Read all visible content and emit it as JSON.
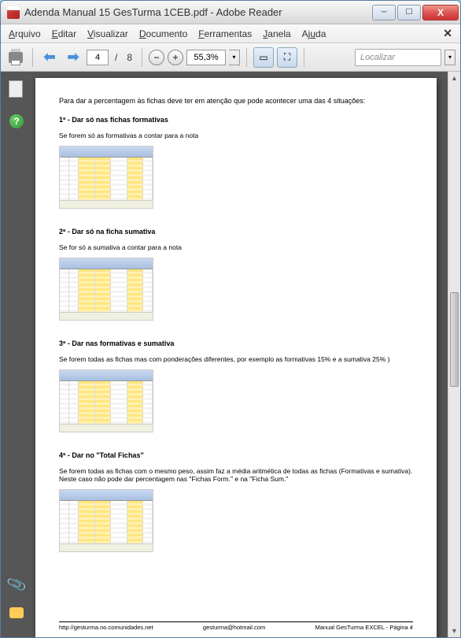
{
  "window": {
    "title": "Adenda Manual 15 GesTurma 1CEB.pdf - Adobe Reader"
  },
  "menu": {
    "arquivo": "Arquivo",
    "editar": "Editar",
    "visualizar": "Visualizar",
    "documento": "Documento",
    "ferramentas": "Ferramentas",
    "janela": "Janela",
    "ajuda": "Ajuda"
  },
  "toolbar": {
    "page_current": "4",
    "page_sep": "/",
    "page_total": "8",
    "zoom_value": "55,3%",
    "search_placeholder": "Localizar"
  },
  "doc": {
    "intro": "Para dar a percentagem às fichas deve ter em atenção que pode acontecer uma das 4 situações:",
    "s1_title": "1ª - Dar só nas fichas formativas",
    "s1_desc": "Se forem só as formativas a contar para a nota",
    "s2_title": "2ª - Dar só na ficha sumativa",
    "s2_desc": "Se for só a sumativa a contar para a nota",
    "s3_title": "3ª - Dar nas formativas e sumativa",
    "s3_desc": "Se forem todas as fichas mas com ponderações diferentes, por exemplo as formativas 15% e a sumativa 25% )",
    "s4_title": "4ª - Dar no \"Total Fichas\"",
    "s4_desc": "Se forem todas as fichas com o mesmo peso, assim faz a média aritmética de todas as fichas (Formativas e sumativa). Neste caso não pode dar percentagem nas \"Fichas Form.\" e na \"Ficha Sum.\"",
    "footer_left": "http://gesturma.no.comunidades.net",
    "footer_center": "gesturma@hotmail.com",
    "footer_right": "Manual GesTurma EXCEL - Página 4"
  }
}
